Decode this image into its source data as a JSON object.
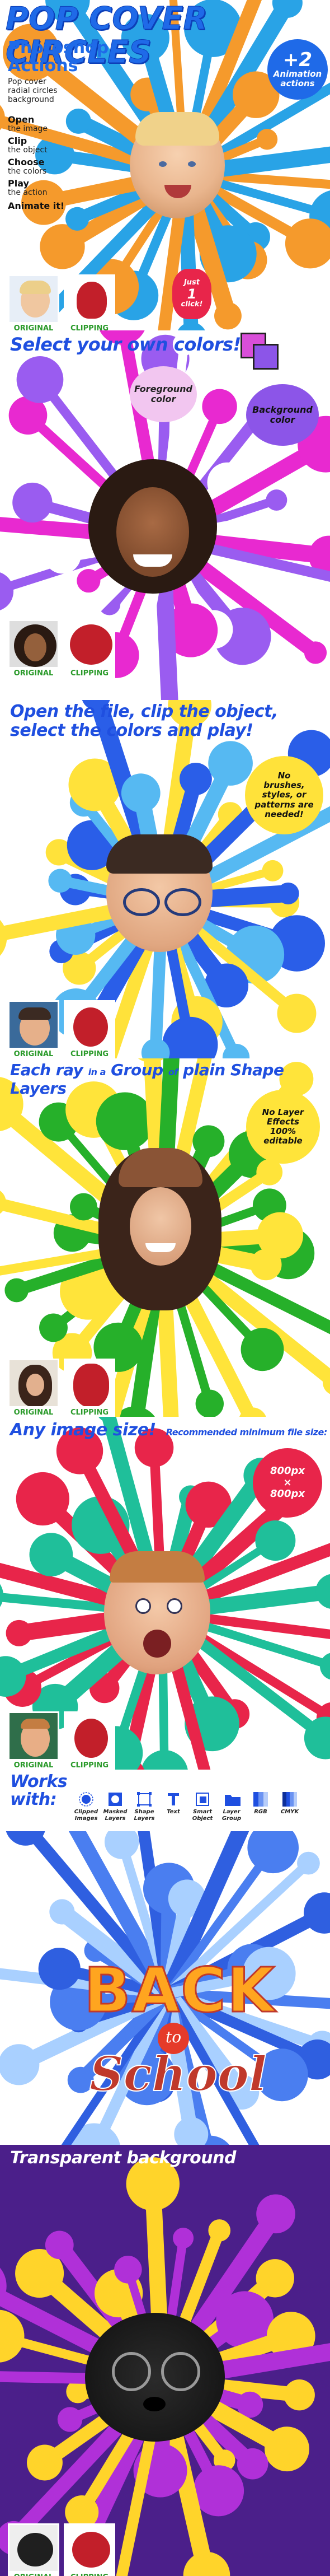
{
  "hero": {
    "title": "POP COVER CIRCLES",
    "subtitle_line1": "Photoshop",
    "subtitle_line2": "Actions",
    "desc_line1": "Pop cover",
    "desc_line2": "radial circles",
    "desc_line3": "background",
    "steps": [
      {
        "bold": "Open",
        "small": "the image"
      },
      {
        "bold": "Clip",
        "small": "the object"
      },
      {
        "bold": "Choose",
        "small": "the colors"
      },
      {
        "bold": "Play",
        "small": "the action"
      }
    ],
    "animate": "Animate it!",
    "badge_big": "+2",
    "badge_line1": "Animation",
    "badge_line2": "actions",
    "click_line1": "Just",
    "click_num": "1",
    "click_line2": "click!",
    "colors": {
      "orange": "#f59a2c",
      "blue": "#29a3e6",
      "title": "#1f6ae8"
    }
  },
  "labels": {
    "original": "ORIGINAL",
    "clipping": "CLIPPING"
  },
  "sec2": {
    "heading": "Select your own colors!",
    "fg_line1": "Foreground",
    "fg_line2": "color",
    "bg_line1": "Background",
    "bg_line2": "color",
    "colors": {
      "magenta": "#e829d0",
      "purple": "#9a5cf0",
      "fg": "#f2c6f0",
      "bg": "#8c55e8"
    }
  },
  "sec3": {
    "heading_line1": "Open the file, clip the object,",
    "heading_line2": "select the colors and play!",
    "bubble_line1": "No",
    "bubble_line2": "brushes,",
    "bubble_line3": "styles, or",
    "bubble_line4": "patterns are",
    "bubble_line5": "needed!",
    "colors": {
      "yellow": "#ffe23a",
      "blue": "#2a5ee8",
      "sky": "#56b9f2"
    }
  },
  "sec4": {
    "heading_part1": "Each ray",
    "heading_part2": "in a",
    "heading_part3": "Group",
    "heading_part4": "of",
    "heading_part5": "plain Shape Layers",
    "bubble_line1": "No Layer",
    "bubble_line2": "Effects",
    "bubble_line3": "100%",
    "bubble_line4": "editable",
    "colors": {
      "green": "#26b02a",
      "yellow": "#ffe43a"
    }
  },
  "sec5": {
    "heading": "Any image size!",
    "heading_small": "Recommended minimum file size:",
    "size_line1": "800px",
    "size_line2": "×",
    "size_line3": "800px",
    "colors": {
      "red": "#e8254a",
      "teal": "#1fbf9a"
    }
  },
  "sec6": {
    "heading_line1": "Works",
    "heading_line2": "with:",
    "tools": [
      {
        "name": "Clipped Images",
        "icon": "clipped-images-icon"
      },
      {
        "name": "Masked Layers",
        "icon": "masked-layers-icon"
      },
      {
        "name": "Shape Layers",
        "icon": "shape-layers-icon"
      },
      {
        "name": "Text",
        "icon": "text-icon"
      },
      {
        "name": "Smart Object",
        "icon": "smart-object-icon"
      },
      {
        "name": "Layer Group",
        "icon": "layer-group-icon"
      },
      {
        "name": "RGB",
        "icon": "rgb-icon"
      },
      {
        "name": "CMYK",
        "icon": "cmyk-icon"
      }
    ],
    "back": "BACK",
    "to": "to",
    "school": "School",
    "colors": {
      "blue": "#4a7ef0",
      "light": "#a9d0ff"
    }
  },
  "sec7": {
    "heading": "Transparent background",
    "colors": {
      "purple": "#4b1f8a",
      "yellow": "#ffd42a",
      "violet": "#b030d8"
    }
  }
}
